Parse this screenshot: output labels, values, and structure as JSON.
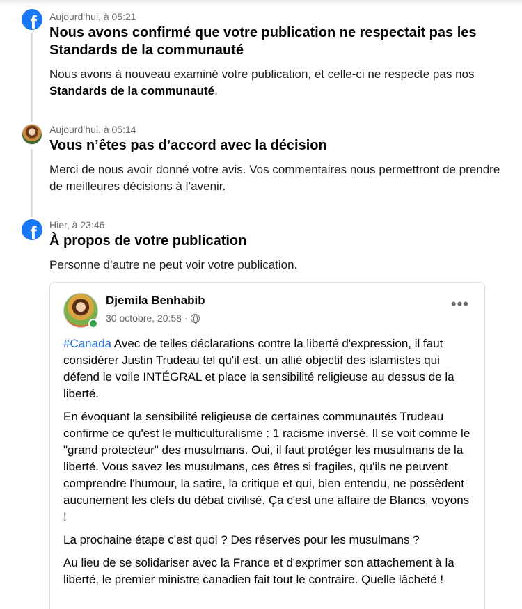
{
  "notifications": [
    {
      "time": "Aujourd’hui, à 05:21",
      "title": "Nous avons confirmé que votre publication ne respectait pas les Standards de la communauté",
      "body_prefix": "Nous avons à nouveau examiné votre publication, et celle-ci ne respecte pas nos ",
      "body_bold": "Standards de la communauté",
      "body_suffix": ".",
      "icon": "facebook-icon"
    },
    {
      "time": "Aujourd’hui, à 05:14",
      "title": "Vous n’êtes pas d’accord avec la décision",
      "body": "Merci de nous avoir donné votre avis. Vos commentaires nous permettront de prendre de meilleures décisions à l’avenir.",
      "icon": "user-avatar"
    },
    {
      "time": "Hier, à 23:46",
      "title": "À propos de votre publication",
      "body": "Personne d’autre ne peut voir votre publication.",
      "icon": "facebook-icon"
    }
  ],
  "post": {
    "author": "Djemila Benhabib",
    "date": "30 octobre, 20:58",
    "separator": "·",
    "privacy_icon": "globe-icon",
    "more_label": "•••",
    "hashtag": "#Canada",
    "paragraph1_rest": " Avec de telles déclarations contre la liberté d'expression, il faut considérer Justin Trudeau tel qu'il est, un allié objectif des islamistes qui défend le voile INTÉGRAL et place la sensibilité religieuse au dessus de la liberté.",
    "paragraph2": "En évoquant la sensibilité religieuse de certaines communautés Trudeau confirme ce qu'est le multiculturalisme : 1 racisme inversé. Il se voit comme le \"grand protecteur\" des musulmans. Oui, il faut protéger les musulmans de la liberté. Vous savez les musulmans, ces êtres si fragiles, qu'ils ne peuvent comprendre l'humour, la satire, la critique et qui, bien entendu, ne possèdent aucunement les clefs du débat civilisé. Ça c'est une affaire  de Blancs, voyons !",
    "paragraph3": "La prochaine étape c'est quoi ?  Des réserves pour les musulmans ?",
    "paragraph4": "Au lieu de se solidariser avec la France et d'exprimer son attachement à la liberté, le premier ministre canadien fait tout le contraire. Quelle lâcheté !"
  },
  "colors": {
    "facebook_blue": "#1877f2",
    "link_blue": "#216fdb",
    "secondary_text": "#65676b",
    "online_green": "#31a24c"
  }
}
